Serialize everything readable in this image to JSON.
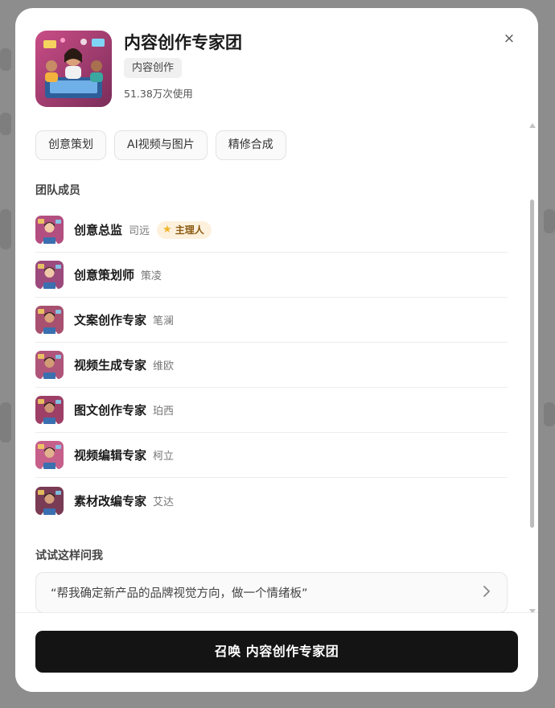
{
  "modal": {
    "title": "内容创作专家团",
    "category": "内容创作",
    "usage": "51.38万次使用",
    "close_glyph": "×"
  },
  "skills": [
    "创意策划",
    "AI视频与图片",
    "精修合成"
  ],
  "members_title": "团队成员",
  "members": [
    {
      "role": "创意总监",
      "name": "司远",
      "badge": "主理人",
      "palette": [
        "#b34f80",
        "#f2c9a6",
        "#3a2a2a"
      ]
    },
    {
      "role": "创意策划师",
      "name": "策凌",
      "palette": [
        "#9c4a7d",
        "#f0c7a8",
        "#4a2e24"
      ]
    },
    {
      "role": "文案创作专家",
      "name": "笔澜",
      "palette": [
        "#a8506f",
        "#d9a27a",
        "#2b1e1a"
      ]
    },
    {
      "role": "视频生成专家",
      "name": "维欧",
      "palette": [
        "#b0557a",
        "#d39b74",
        "#2a1f1a"
      ]
    },
    {
      "role": "图文创作专家",
      "name": "珀西",
      "palette": [
        "#9d3f66",
        "#cc9474",
        "#24190f"
      ]
    },
    {
      "role": "视频编辑专家",
      "name": "柯立",
      "palette": [
        "#c6608a",
        "#e2b18d",
        "#3b2b20"
      ]
    },
    {
      "role": "素材改编专家",
      "name": "艾达",
      "palette": [
        "#7a3b55",
        "#d4a07b",
        "#2b2420"
      ]
    }
  ],
  "try_title": "试试这样问我",
  "prompts": [
    "“帮我确定新产品的品牌视觉方向，做一个情绪板”"
  ],
  "footer": {
    "button_label": "召唤 内容创作专家团"
  },
  "colors": {
    "primary_button": "#141414",
    "badge_bg": "#fdf1dd",
    "badge_text": "#8a5a12"
  }
}
